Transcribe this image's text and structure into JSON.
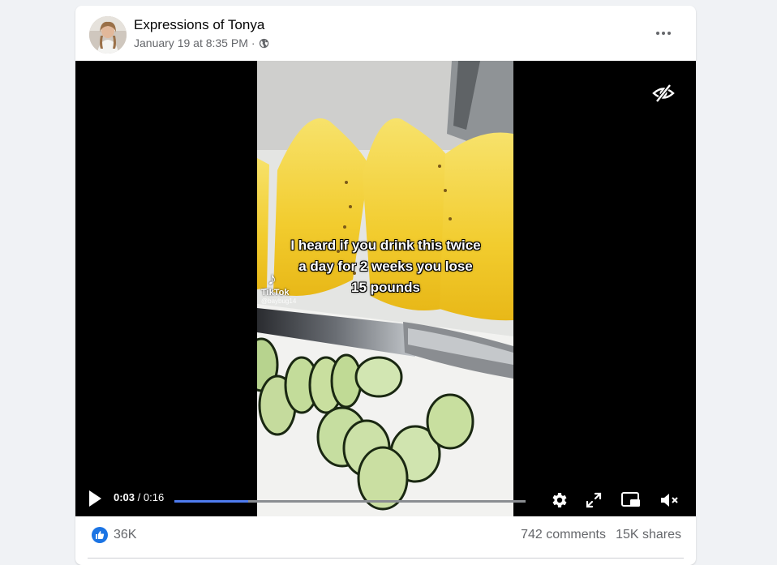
{
  "post": {
    "author": "Expressions of Tonya",
    "timestamp": "January 19 at 8:35 PM",
    "separator": "·",
    "privacy_icon": "globe-icon",
    "more_icon": "more-options-icon"
  },
  "video": {
    "caption_lines": [
      "I heard if you drink this twice",
      "a day for 2 weeks you lose",
      "15 pounds"
    ],
    "watermark": {
      "brand": "TikTok",
      "handle": "@baybug14"
    },
    "current_time": "0:03",
    "time_separator": "/",
    "duration": "0:16",
    "progress_fraction": 0.21,
    "icons": [
      "hide-icon",
      "play-icon",
      "settings-icon",
      "fullscreen-icon",
      "picture-in-picture-icon",
      "mute-icon"
    ]
  },
  "footer": {
    "likes": "36K",
    "comments": "742 comments",
    "shares": "15K shares",
    "like_icon": "thumbs-up-icon"
  },
  "colors": {
    "accent": "#4f7cf0",
    "like_blue": "#1b74e4",
    "text_primary": "#050505",
    "text_secondary": "#65676b",
    "video_bg": "#000000"
  }
}
